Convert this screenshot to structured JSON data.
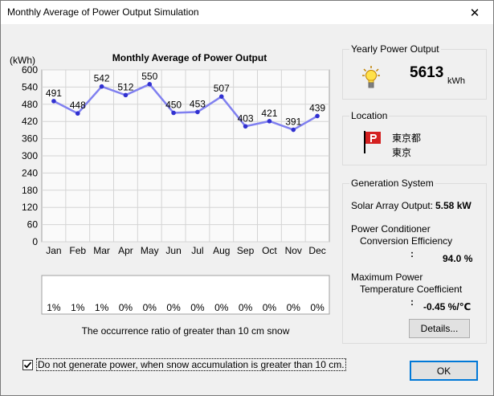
{
  "window": {
    "title": "Monthly Average of Power Output Simulation",
    "close_glyph": "✕"
  },
  "chart_data": {
    "type": "line",
    "title": "Monthly Average of Power Output",
    "ylabel": "(kWh)",
    "ylim": [
      0,
      600
    ],
    "yticks": [
      0,
      60,
      120,
      180,
      240,
      300,
      360,
      420,
      480,
      540,
      600
    ],
    "categories": [
      "Jan",
      "Feb",
      "Mar",
      "Apr",
      "May",
      "Jun",
      "Jul",
      "Aug",
      "Sep",
      "Oct",
      "Nov",
      "Dec"
    ],
    "values": [
      491,
      448,
      542,
      512,
      550,
      450,
      453,
      507,
      403,
      421,
      391,
      439
    ],
    "grid": true,
    "line_color": "#8080f0",
    "marker_color": "#3030d0"
  },
  "snow": {
    "ratios": [
      "1%",
      "1%",
      "1%",
      "0%",
      "0%",
      "0%",
      "0%",
      "0%",
      "0%",
      "0%",
      "0%",
      "0%"
    ],
    "caption": "The occurrence ratio of greater than 10 cm snow"
  },
  "yearly": {
    "title": "Yearly Power Output",
    "value": "5613",
    "unit": "kWh"
  },
  "location": {
    "title": "Location",
    "line1": "東京都",
    "line2": "東京"
  },
  "generation": {
    "title": "Generation System",
    "solar_label": "Solar Array Output:",
    "solar_value": "5.58 kW",
    "pc_label1": "Power Conditioner",
    "pc_label2": "Conversion Efficiency",
    "pc_colon": ":",
    "pc_value": "94.0 %",
    "mp_label1": "Maximum Power",
    "mp_label2": "Temperature Coefficient",
    "mp_colon": ":",
    "mp_value": "-0.45 %/℃",
    "details_label": "Details..."
  },
  "checkbox": {
    "checked": true,
    "label": "Do not generate power, when snow accumulation is greater than 10 cm."
  },
  "ok_label": "OK"
}
